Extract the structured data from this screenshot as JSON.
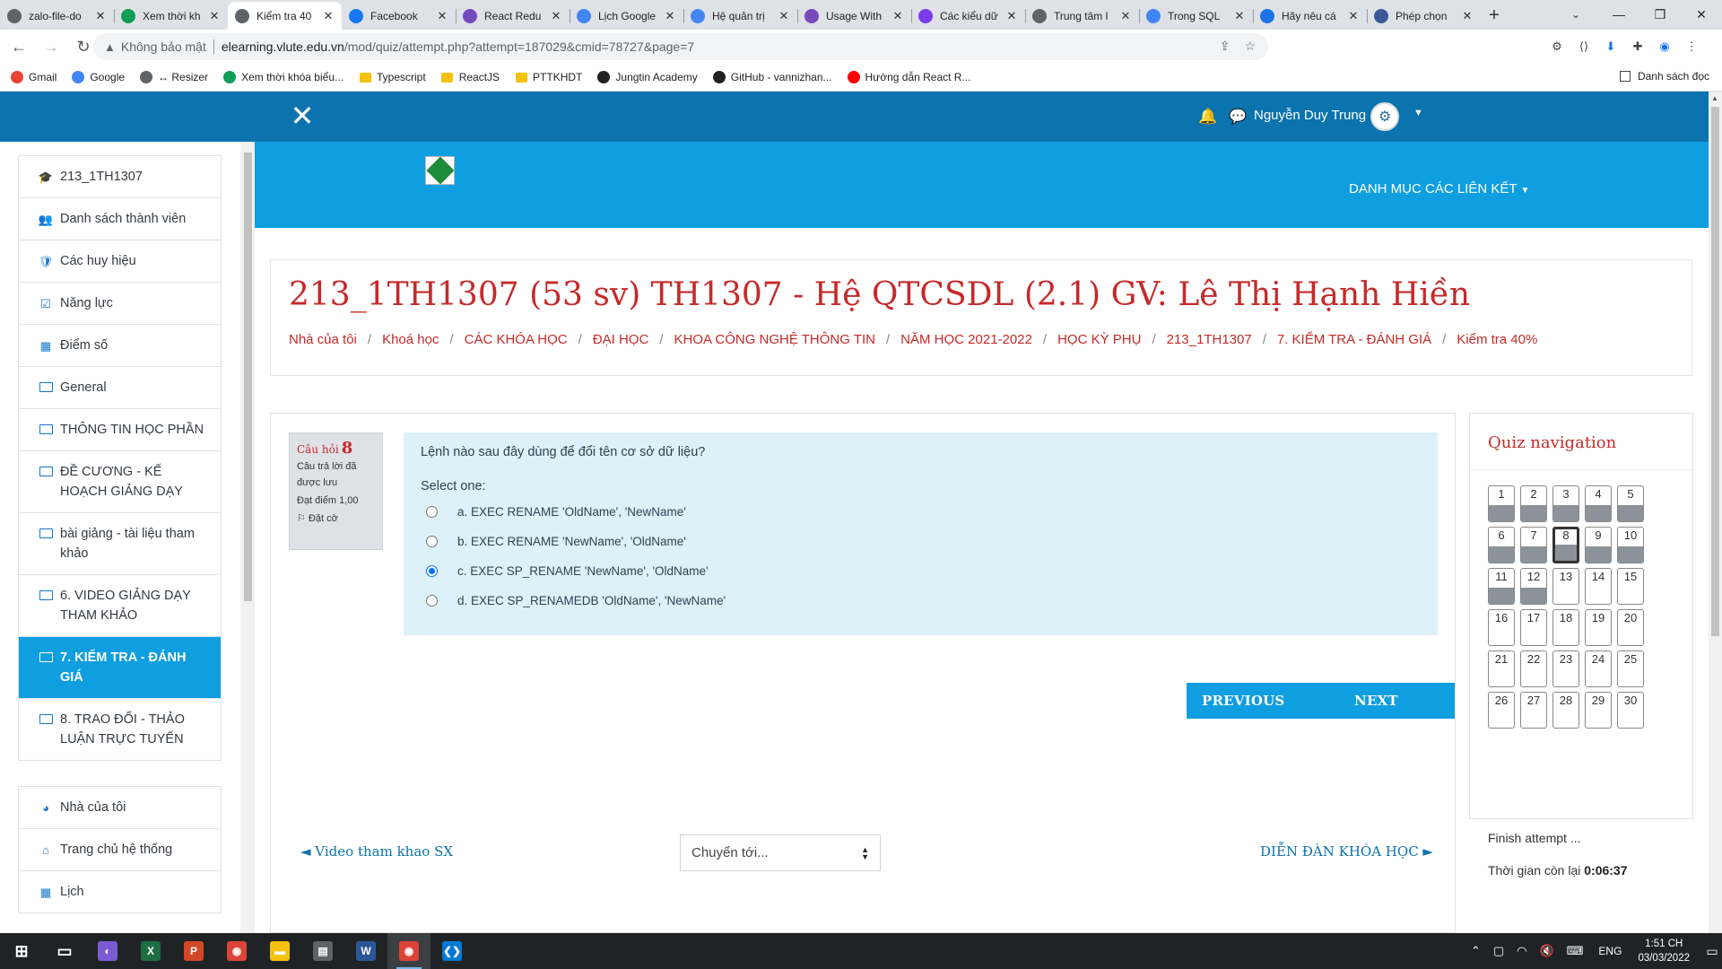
{
  "browser": {
    "tabs": [
      {
        "title": "zalo-file-do",
        "color": "#5f6368",
        "icon": "globe-icon"
      },
      {
        "title": "Xem thời kh",
        "color": "#0f9d58",
        "icon": "diamond-icon"
      },
      {
        "title": "Kiểm tra 40",
        "color": "#5f6368",
        "icon": "document-icon",
        "active": true
      },
      {
        "title": "Facebook",
        "color": "#1877f2",
        "icon": "facebook-icon"
      },
      {
        "title": "React Redu",
        "color": "#764abc",
        "icon": "redux-icon"
      },
      {
        "title": "Lịch Google",
        "color": "#4285f4",
        "icon": "calendar-icon"
      },
      {
        "title": "Hệ quản trị",
        "color": "#4285f4",
        "icon": "google-icon"
      },
      {
        "title": "Usage With",
        "color": "#764abc",
        "icon": "redux-icon"
      },
      {
        "title": "Các kiểu dữ",
        "color": "#7c3aed",
        "icon": "site-icon"
      },
      {
        "title": "Trung tâm l",
        "color": "#5f6368",
        "icon": "globe-icon"
      },
      {
        "title": "Trong SQL",
        "color": "#4285f4",
        "icon": "google-icon"
      },
      {
        "title": "Hãy nêu cá",
        "color": "#1a73e8",
        "icon": "bookmark-icon"
      },
      {
        "title": "Phép chọn",
        "color": "#3b5998",
        "icon": "check-icon"
      }
    ],
    "window_controls": {
      "minimize": "—",
      "maximize": "❐",
      "close": "✕"
    },
    "url": {
      "insecure_label": "Không bảo mật",
      "host": "elearning.vlute.edu.vn",
      "path": "/mod/quiz/attempt.php?attempt=187029&cmid=78727&page=7"
    },
    "bookmarks": [
      {
        "label": "Gmail",
        "icon": "gmail-icon",
        "color": "#ea4335"
      },
      {
        "label": "Google",
        "icon": "google-icon",
        "color": "#4285f4"
      },
      {
        "label": "↔ Resizer",
        "icon": "globe-icon",
        "color": "#5f6368"
      },
      {
        "label": "Xem thời khóa biểu...",
        "icon": "diamond-icon",
        "color": "#0f9d58"
      },
      {
        "label": "Typescript",
        "icon": "folder-icon",
        "color": "#f4c20d"
      },
      {
        "label": "ReactJS",
        "icon": "folder-icon",
        "color": "#f4c20d"
      },
      {
        "label": "PTTKHDT",
        "icon": "folder-icon",
        "color": "#f4c20d"
      },
      {
        "label": "Jungtin Academy",
        "icon": "site-icon",
        "color": "#222222"
      },
      {
        "label": "GitHub - vannizhan...",
        "icon": "github-icon",
        "color": "#222222"
      },
      {
        "label": "Hướng dẫn React R...",
        "icon": "youtube-icon",
        "color": "#ff0000"
      }
    ],
    "reading_list": "Danh sách đọc"
  },
  "header": {
    "username": "Nguyễn Duy Trung",
    "links_menu": "DANH MỤC CÁC LIÊN KẾT"
  },
  "sidebar": {
    "group1": [
      {
        "label": "213_1TH1307",
        "icon": "graduation-cap-icon",
        "glyph": "🎓"
      },
      {
        "label": "Danh sách thành viên",
        "icon": "users-icon",
        "glyph": "👥"
      },
      {
        "label": "Các huy hiệu",
        "icon": "shield-icon",
        "glyph": "🛡"
      },
      {
        "label": "Năng lực",
        "icon": "checkbox-icon",
        "glyph": "☑"
      },
      {
        "label": "Điểm số",
        "icon": "table-icon",
        "glyph": "▦"
      },
      {
        "label": "General",
        "icon": "folder-icon"
      },
      {
        "label": "THÔNG TIN HỌC PHẦN",
        "icon": "folder-icon"
      },
      {
        "label": "ĐỀ CƯƠNG - KẾ HOẠCH GIẢNG DẠY",
        "icon": "folder-icon"
      },
      {
        "label": "bài giảng - tài liệu tham khảo",
        "icon": "folder-icon"
      },
      {
        "label": "6. VIDEO GIẢNG DẠY THAM KHẢO",
        "icon": "folder-icon"
      },
      {
        "label": "7. KIỂM TRA - ĐÁNH GIÁ",
        "icon": "folder-icon",
        "active": true
      },
      {
        "label": "8. TRAO ĐỔI - THẢO LUẬN TRỰC TUYẾN",
        "icon": "folder-icon"
      }
    ],
    "group2": [
      {
        "label": "Nhà của tôi",
        "icon": "dashboard-icon",
        "glyph": "◕"
      },
      {
        "label": "Trang chủ hệ thống",
        "icon": "home-icon",
        "glyph": "⌂"
      },
      {
        "label": "Lịch",
        "icon": "calendar-icon",
        "glyph": "▦"
      }
    ]
  },
  "course": {
    "title": "213_1TH1307 (53 sv) TH1307 - Hệ QTCSDL (2.1) GV: Lê Thị Hạnh Hiền",
    "breadcrumb": [
      "Nhà của tôi",
      "Khoá học",
      "CÁC KHÓA HỌC",
      "ĐẠI HỌC",
      "KHOA CÔNG NGHỆ THÔNG TIN",
      "NĂM HỌC 2021-2022",
      "HỌC KỲ PHỤ",
      "213_1TH1307",
      "7. KIỂM TRA - ĐÁNH GIÁ",
      "Kiểm tra 40%"
    ]
  },
  "question": {
    "label": "Câu hỏi",
    "number": "8",
    "state": "Câu trả lời đã được lưu",
    "marks": "Đạt điểm 1,00",
    "flag": "Đặt cờ",
    "text": "Lệnh nào sau đây dùng để đổi tên cơ sở dữ liệu?",
    "prompt": "Select one:",
    "answers": [
      {
        "text": "a. EXEC RENAME 'OldName', 'NewName'",
        "checked": false
      },
      {
        "text": "b. EXEC RENAME 'NewName', 'OldName'",
        "checked": false
      },
      {
        "text": "c. EXEC SP_RENAME 'NewName', 'OldName'",
        "checked": true
      },
      {
        "text": "d. EXEC SP_RENAMEDB 'OldName', 'NewName'",
        "checked": false
      }
    ]
  },
  "buttons": {
    "previous_page": "PREVIOUS PAGE",
    "next_page": "NEXT PAGE"
  },
  "activity_nav": {
    "prev": "◄ Video tham khao SX",
    "jump_placeholder": "Chuyển tới...",
    "next": "DIỄN ĐÀN KHÓA HỌC ►"
  },
  "quiz_nav": {
    "title": "Quiz navigation",
    "questions": [
      {
        "n": "1",
        "answered": true
      },
      {
        "n": "2",
        "answered": true
      },
      {
        "n": "3",
        "answered": true
      },
      {
        "n": "4",
        "answered": true
      },
      {
        "n": "5",
        "answered": true
      },
      {
        "n": "6",
        "answered": true
      },
      {
        "n": "7",
        "answered": true
      },
      {
        "n": "8",
        "answered": true,
        "current": true
      },
      {
        "n": "9",
        "answered": true
      },
      {
        "n": "10",
        "answered": true
      },
      {
        "n": "11",
        "answered": true
      },
      {
        "n": "12",
        "answered": true
      },
      {
        "n": "13",
        "answered": false
      },
      {
        "n": "14",
        "answered": false
      },
      {
        "n": "15",
        "answered": false
      },
      {
        "n": "16",
        "answered": false
      },
      {
        "n": "17",
        "answered": false
      },
      {
        "n": "18",
        "answered": false
      },
      {
        "n": "19",
        "answered": false
      },
      {
        "n": "20",
        "answered": false
      },
      {
        "n": "21",
        "answered": false
      },
      {
        "n": "22",
        "answered": false
      },
      {
        "n": "23",
        "answered": false
      },
      {
        "n": "24",
        "answered": false
      },
      {
        "n": "25",
        "answered": false
      },
      {
        "n": "26",
        "answered": false
      },
      {
        "n": "27",
        "answered": false
      },
      {
        "n": "28",
        "answered": false
      },
      {
        "n": "29",
        "answered": false
      },
      {
        "n": "30",
        "answered": false
      }
    ],
    "finish": "Finish attempt ...",
    "time_label": "Thời gian còn lại",
    "time_value": "0:06:37"
  },
  "taskbar": {
    "apps": [
      {
        "icon": "windows-start-icon",
        "color": "#ffffff",
        "glyph": "⊞"
      },
      {
        "icon": "task-view-icon",
        "color": "#ffffff",
        "glyph": "▭"
      },
      {
        "icon": "game-app-icon",
        "color": "#7a5bd1",
        "glyph": "◐"
      },
      {
        "icon": "excel-icon",
        "color": "#1d6f42",
        "glyph": "X"
      },
      {
        "icon": "powerpoint-icon",
        "color": "#d24726",
        "glyph": "P"
      },
      {
        "icon": "chrome-icon",
        "color": "#db4437",
        "glyph": "◉"
      },
      {
        "icon": "file-explorer-icon",
        "color": "#f4c20d",
        "glyph": "▬"
      },
      {
        "icon": "calculator-icon",
        "color": "#5f6368",
        "glyph": "▤"
      },
      {
        "icon": "word-icon",
        "color": "#2b579a",
        "glyph": "W"
      },
      {
        "icon": "chrome-icon",
        "color": "#db4437",
        "glyph": "◉",
        "active": true
      },
      {
        "icon": "vscode-icon",
        "color": "#0078d4",
        "glyph": "❮❯"
      }
    ],
    "language": "ENG",
    "time": "1:51 CH",
    "date": "03/03/2022"
  }
}
